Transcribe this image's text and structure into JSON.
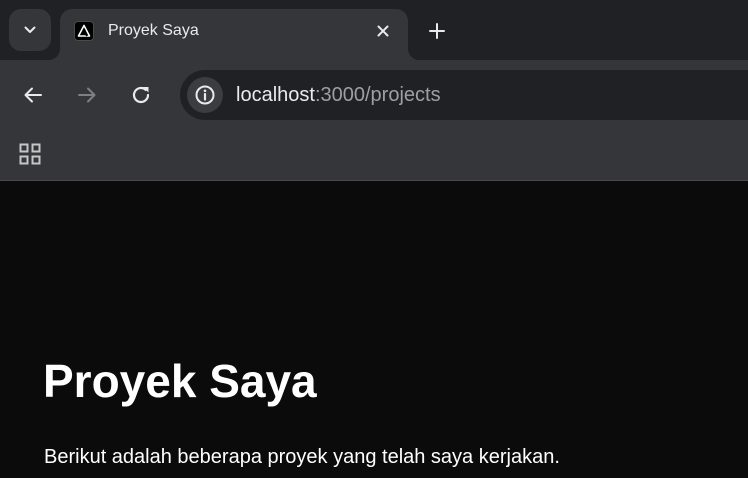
{
  "tab": {
    "title": "Proyek Saya",
    "favicon": "vercel-triangle-icon"
  },
  "toolbar": {
    "url_host": "localhost",
    "url_path": ":3000/projects"
  },
  "icons": {
    "tab_search": "chevron-down-icon",
    "close": "close-icon",
    "new_tab": "plus-icon",
    "back": "arrow-left-icon",
    "forward": "arrow-right-icon",
    "reload": "reload-icon",
    "site_info": "info-icon",
    "apps": "apps-grid-icon"
  },
  "page": {
    "title": "Proyek Saya",
    "description": "Berikut adalah beberapa proyek yang telah saya kerjakan."
  },
  "colors": {
    "tabstrip": "#202124",
    "toolbar": "#35363a",
    "page_background": "#0b0b0b",
    "text": "#ffffff"
  }
}
